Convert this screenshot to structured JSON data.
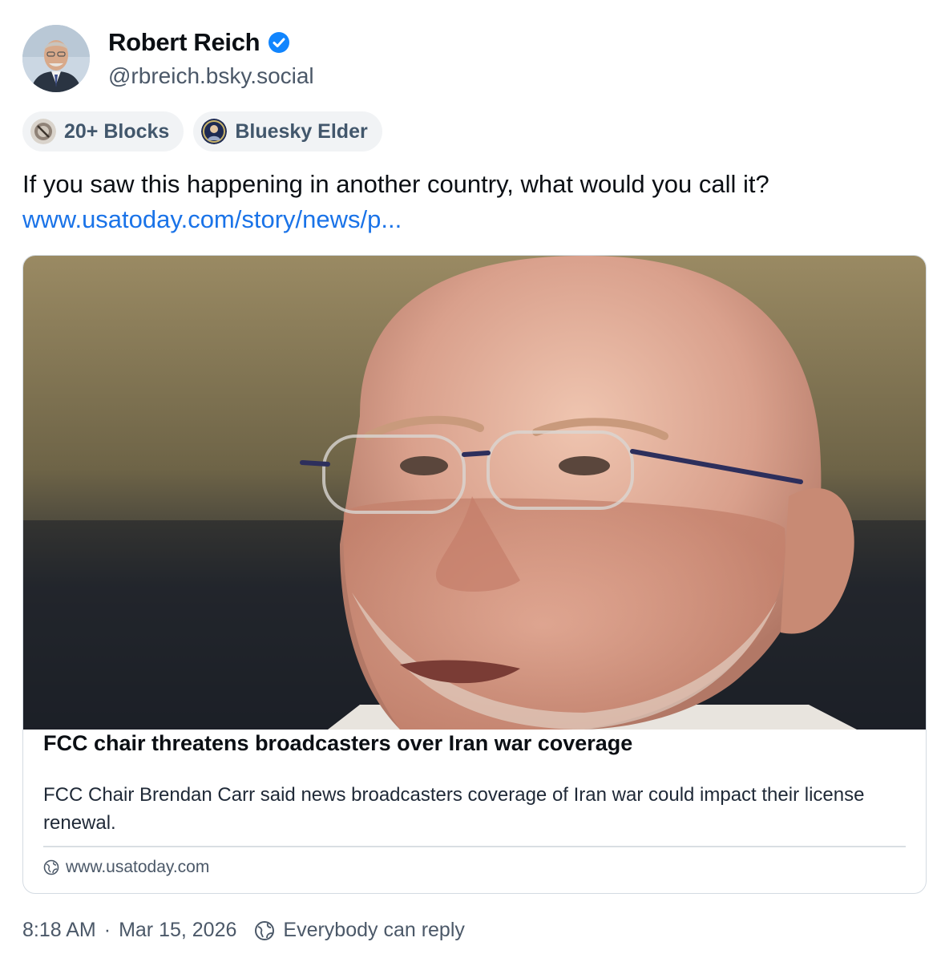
{
  "author": {
    "name": "Robert Reich",
    "handle": "@rbreich.bsky.social",
    "verified": true,
    "avatar_icon": "avatar-photo"
  },
  "badges": [
    {
      "label": "20+ Blocks",
      "icon": "blocks-badge-icon"
    },
    {
      "label": "Bluesky Elder",
      "icon": "elder-badge-icon"
    }
  ],
  "post": {
    "text": "If you saw this happening in another country, what would you call it?",
    "link_text": "www.usatoday.com/story/news/p..."
  },
  "card": {
    "image_icon": "news-photo",
    "title": "FCC chair threatens broadcasters over Iran war coverage",
    "description": "FCC Chair Brendan Carr said news broadcasters coverage of Iran war could impact their license renewal.",
    "domain": "www.usatoday.com"
  },
  "footer": {
    "time": "8:18 AM",
    "separator": "·",
    "date": "Mar 15, 2026",
    "reply_setting": "Everybody can reply"
  },
  "colors": {
    "link": "#1a73e8",
    "verified": "#1185fe",
    "muted_text": "#4b5868",
    "badge_bg": "#f1f3f5"
  }
}
